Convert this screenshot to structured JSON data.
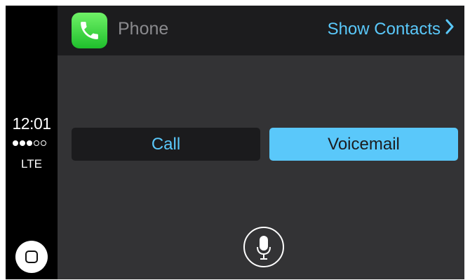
{
  "status_bar": {
    "time": "12:01",
    "signal_strength": {
      "filled": 3,
      "total": 5
    },
    "network": "LTE"
  },
  "header": {
    "app_icon": "phone-icon",
    "app_title": "Phone",
    "show_contacts_label": "Show Contacts",
    "show_contacts_icon": "chevron-right-icon"
  },
  "main": {
    "call_label": "Call",
    "voicemail_label": "Voicemail",
    "siri_icon": "microphone-icon"
  },
  "home_icon": "home-square-icon",
  "colors": {
    "accent": "#5ac8fa",
    "app_icon_green": "#2bc637",
    "header_bg": "#1c1c1e",
    "content_bg": "#333335",
    "rail_bg": "#000000"
  }
}
